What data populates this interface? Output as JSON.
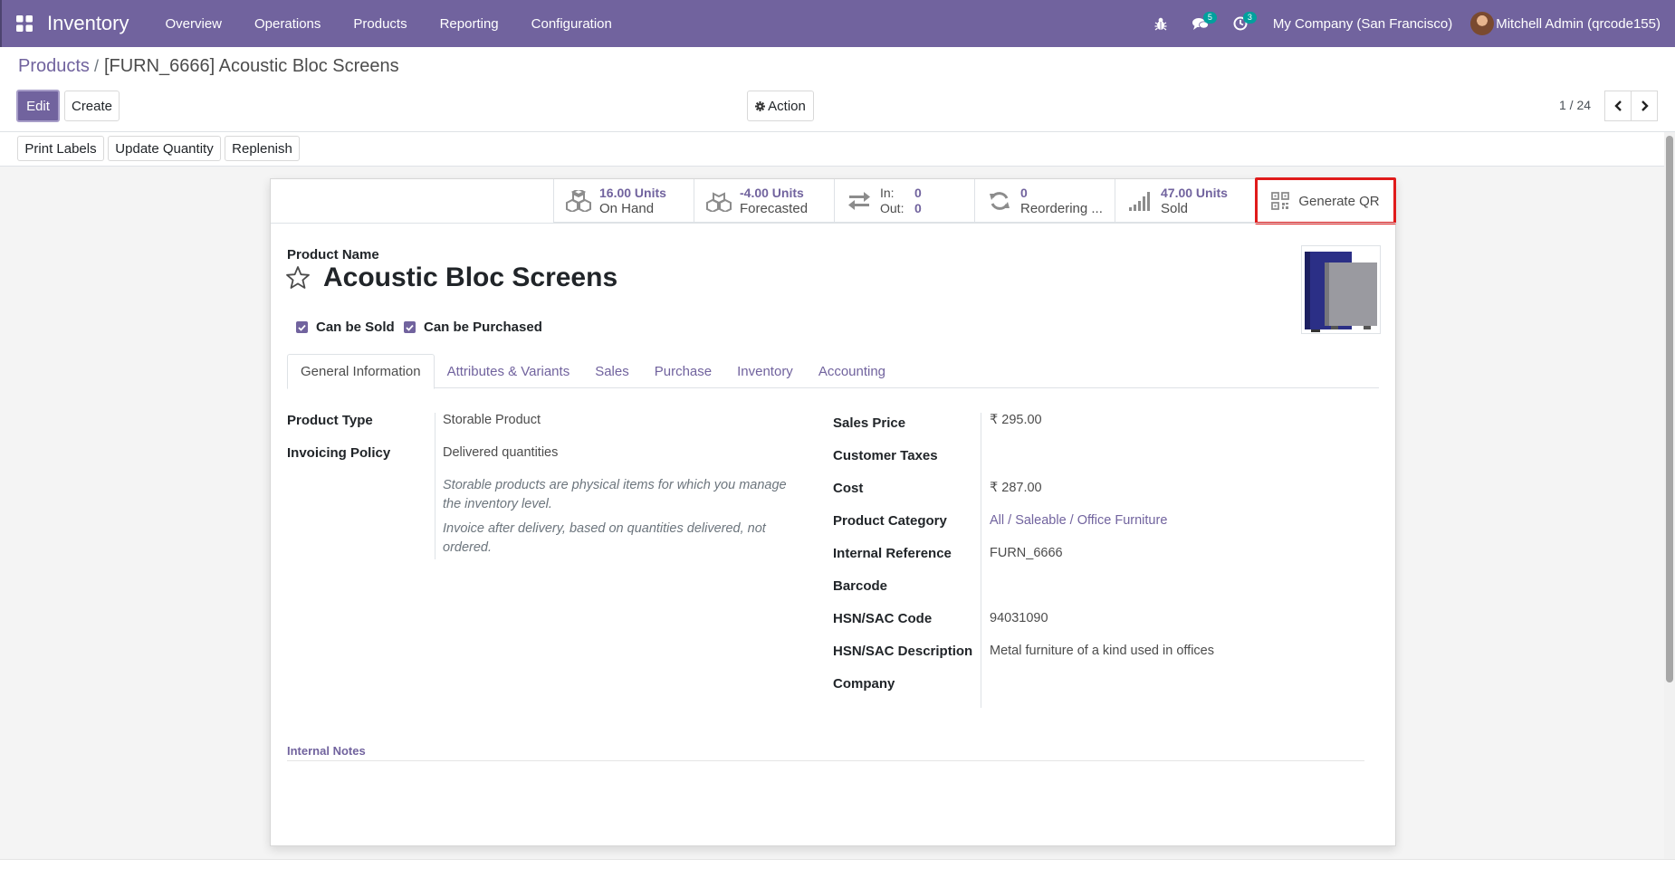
{
  "navbar": {
    "app_name": "Inventory",
    "menu": [
      "Overview",
      "Operations",
      "Products",
      "Reporting",
      "Configuration"
    ],
    "messages_count": "5",
    "activities_count": "3",
    "company": "My Company (San Francisco)",
    "user": "Mitchell Admin (qrcode155)"
  },
  "breadcrumb": {
    "parent": "Products",
    "separator": "/",
    "current": "[FURN_6666] Acoustic Bloc Screens"
  },
  "control": {
    "edit_label": "Edit",
    "create_label": "Create",
    "action_label": "Action",
    "pager": "1 / 24"
  },
  "header_buttons": {
    "print_labels": "Print Labels",
    "update_quantity": "Update Quantity",
    "replenish": "Replenish"
  },
  "stats": {
    "on_hand_value": "16.00 Units",
    "on_hand_label": "On Hand",
    "forecasted_value": "-4.00 Units",
    "forecasted_label": "Forecasted",
    "in_label": "In:",
    "in_value": "0",
    "out_label": "Out:",
    "out_value": "0",
    "reordering_value": "0",
    "reordering_label": "Reordering ...",
    "sold_value": "47.00 Units",
    "sold_label": "Sold",
    "generate_qr": "Generate QR"
  },
  "product": {
    "name_label": "Product Name",
    "name": "Acoustic Bloc Screens",
    "can_be_sold": "Can be Sold",
    "can_be_purchased": "Can be Purchased"
  },
  "tabs": [
    "General Information",
    "Attributes & Variants",
    "Sales",
    "Purchase",
    "Inventory",
    "Accounting"
  ],
  "general": {
    "product_type_label": "Product Type",
    "product_type": "Storable Product",
    "invoicing_policy_label": "Invoicing Policy",
    "invoicing_policy": "Delivered quantities",
    "help_storable": "Storable products are physical items for which you manage the inventory level.",
    "help_invoice": "Invoice after delivery, based on quantities delivered, not ordered.",
    "sales_price_label": "Sales Price",
    "sales_price": "₹ 295.00",
    "customer_taxes_label": "Customer Taxes",
    "cost_label": "Cost",
    "cost": "₹ 287.00",
    "product_category_label": "Product Category",
    "product_category": "All / Saleable / Office Furniture",
    "internal_reference_label": "Internal Reference",
    "internal_reference": "FURN_6666",
    "barcode_label": "Barcode",
    "hsn_code_label": "HSN/SAC Code",
    "hsn_code": "94031090",
    "hsn_description_label": "HSN/SAC Description",
    "hsn_description": "Metal furniture of a kind used in offices",
    "company_label": "Company",
    "internal_notes_label": "Internal Notes"
  },
  "colors": {
    "brand": "#71639e",
    "highlight": "#e01b1b"
  }
}
